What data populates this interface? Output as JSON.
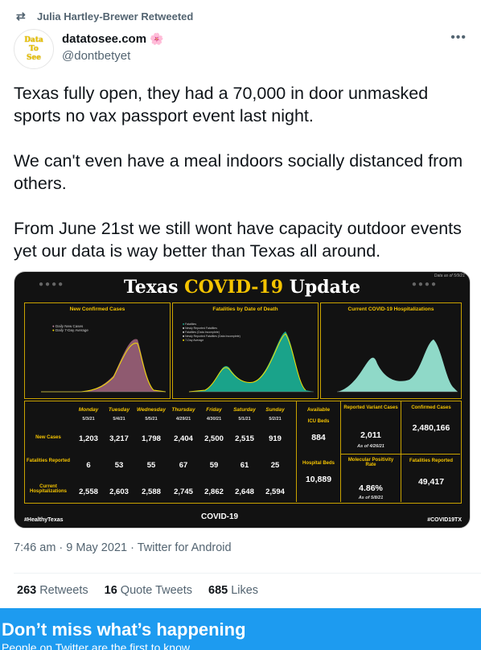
{
  "retweet": {
    "icon": "retweet-icon",
    "text": "Julia Hartley-Brewer Retweeted"
  },
  "author": {
    "avatar_lines": [
      "Data",
      "To",
      "See"
    ],
    "name": "datatosee.com",
    "name_emoji": "🌸",
    "handle": "@dontbetyet",
    "more_icon": "more-icon"
  },
  "tweet": {
    "paragraphs": [
      "Texas fully open, they had a 70,000 in door unmasked sports no vax passport event last night.",
      "We can't even have a meal indoors socially distanced from others.",
      "From June 21st we still wont have capacity outdoor events yet our data is way better than Texas all around."
    ]
  },
  "media": {
    "title_a": "Texas ",
    "title_b": "COVID-19",
    "title_c": " Update",
    "date_note": "Data as of 5/9/21",
    "panels": [
      {
        "title": "New Confirmed Cases",
        "legend": [
          "Daily New Cases",
          "Daily 7-Day Average"
        ]
      },
      {
        "title": "Fatalities by Date of Death",
        "legend": [
          "Fatalities",
          "Newly Reported Fatalities",
          "Fatalities (Data Incomplete)",
          "Newly Reported Fatalities (Data Incomplete)",
          "7-Day Average"
        ]
      },
      {
        "title": "Current COVID-19 Hospitalizations",
        "legend": []
      }
    ],
    "table": {
      "days": [
        "Monday",
        "Tuesday",
        "Wednesday",
        "Thursday",
        "Friday",
        "Saturday",
        "Sunday"
      ],
      "dates": [
        "5/3/21",
        "5/4/21",
        "5/5/21",
        "4/29/21",
        "4/30/21",
        "5/1/21",
        "5/2/21"
      ],
      "rows": [
        {
          "label": "New Cases",
          "values": [
            "1,203",
            "3,217",
            "1,798",
            "2,404",
            "2,500",
            "2,515",
            "919"
          ]
        },
        {
          "label": "Fatalities Reported",
          "values": [
            "6",
            "53",
            "55",
            "67",
            "59",
            "61",
            "25"
          ]
        },
        {
          "label": "Current Hospitalizations",
          "values": [
            "2,558",
            "2,603",
            "2,588",
            "2,745",
            "2,862",
            "2,648",
            "2,594"
          ]
        }
      ],
      "available": {
        "header": "Available",
        "icu_label": "ICU Beds",
        "icu_value": "884",
        "hosp_label": "Hospital Beds",
        "hosp_value": "10,889"
      },
      "variant": {
        "label": "Reported Variant Cases",
        "value": "2,011",
        "note": "As of 4/26/21"
      },
      "molecular": {
        "label": "Molecular Positivity Rate",
        "value": "4.86%",
        "note": "As of 5/8/21"
      },
      "confirmed": {
        "label": "Confirmed Cases",
        "value": "2,480,166"
      },
      "fatalities": {
        "label": "Fatalities Reported",
        "value": "49,417"
      }
    },
    "footer_left": "#HealthyTexas",
    "footer_center": "COVID-19",
    "footer_right": "#COVID19TX"
  },
  "meta": {
    "time": "7:46 am",
    "date": "9 May 2021",
    "source": "Twitter for Android"
  },
  "stats": [
    {
      "count": "263",
      "label": "Retweets"
    },
    {
      "count": "16",
      "label": "Quote Tweets"
    },
    {
      "count": "685",
      "label": "Likes"
    }
  ],
  "banner": {
    "title": "Don’t miss what’s happening",
    "subtitle": "People on Twitter are the first to know."
  },
  "colors": {
    "accent": "#1d9bf0",
    "chart_gold": "#f5c400",
    "teal": "#1aa38a",
    "mauve": "#8f5a70",
    "hosp": "#8fd9c8"
  }
}
